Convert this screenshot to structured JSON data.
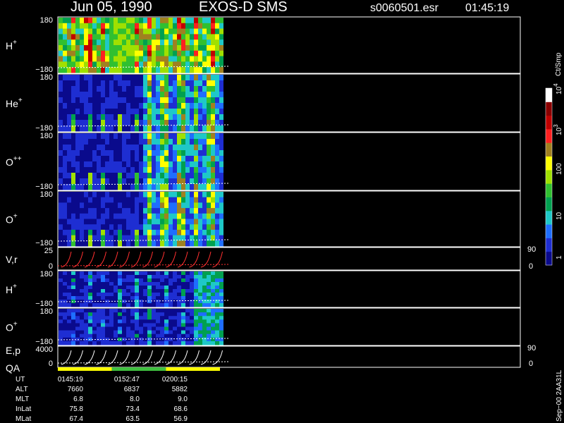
{
  "header": {
    "date": "Jun 05, 1990",
    "instrument": "EXOS-D SMS",
    "file": "s0060501.esr",
    "time": "01:45:19"
  },
  "colorbar": {
    "unit": "Ct/Smp",
    "ticks": [
      "1",
      "10",
      "100",
      "10",
      "10"
    ],
    "exponents": [
      "",
      "",
      "",
      "3",
      "4"
    ],
    "colors": [
      "#0a0a8c",
      "#1e2ed2",
      "#1e6eff",
      "#1ec8c8",
      "#00a050",
      "#30c030",
      "#a0e000",
      "#ffff00",
      "#a08020",
      "#ff2020",
      "#c00000",
      "#8b0000",
      "#ffffff"
    ]
  },
  "chart_data": {
    "type": "heatmap",
    "panels": [
      {
        "label": "H",
        "sup": "+",
        "ymax": "180",
        "ymin": "−180",
        "pattern": "strong"
      },
      {
        "label": "He",
        "sup": "+",
        "ymax": "180",
        "ymin": "−180",
        "pattern": "medium"
      },
      {
        "label": "O",
        "sup": "++",
        "ymax": "180",
        "ymin": "−180",
        "pattern": "medium"
      },
      {
        "label": "O",
        "sup": "+",
        "ymax": "180",
        "ymin": "−180",
        "pattern": "medium"
      },
      {
        "label": "V,r",
        "sup": "",
        "ymax": "25",
        "ymin": "0",
        "right_top": "90",
        "right_bottom": "0",
        "pattern": "line"
      },
      {
        "label": "H",
        "sup": "+",
        "ymax": "180",
        "ymin": "−180",
        "pattern": "weak"
      },
      {
        "label": "O",
        "sup": "+",
        "ymax": "180",
        "ymin": "−180",
        "pattern": "weak"
      },
      {
        "label": "E,p",
        "label2": "QA",
        "sup": "",
        "ymax": "4000",
        "ymin": "0",
        "right_top": "90",
        "right_bottom": "0",
        "pattern": "line"
      }
    ],
    "qa_bar": [
      "#ffff00",
      "#40c040",
      "#ffff00"
    ]
  },
  "footer": {
    "rows": [
      {
        "name": "UT",
        "values": [
          "0145:19",
          "0152:47",
          "0200:15"
        ]
      },
      {
        "name": "ALT",
        "values": [
          "7660",
          "6837",
          "5882"
        ]
      },
      {
        "name": "MLT",
        "values": [
          "6.8",
          "8.0",
          "9.0"
        ]
      },
      {
        "name": "InLat",
        "values": [
          "75.8",
          "73.4",
          "68.6"
        ]
      },
      {
        "name": "MLat",
        "values": [
          "67.4",
          "63.5",
          "56.9"
        ]
      }
    ],
    "side_note": "Sep−00 2AA31L"
  }
}
